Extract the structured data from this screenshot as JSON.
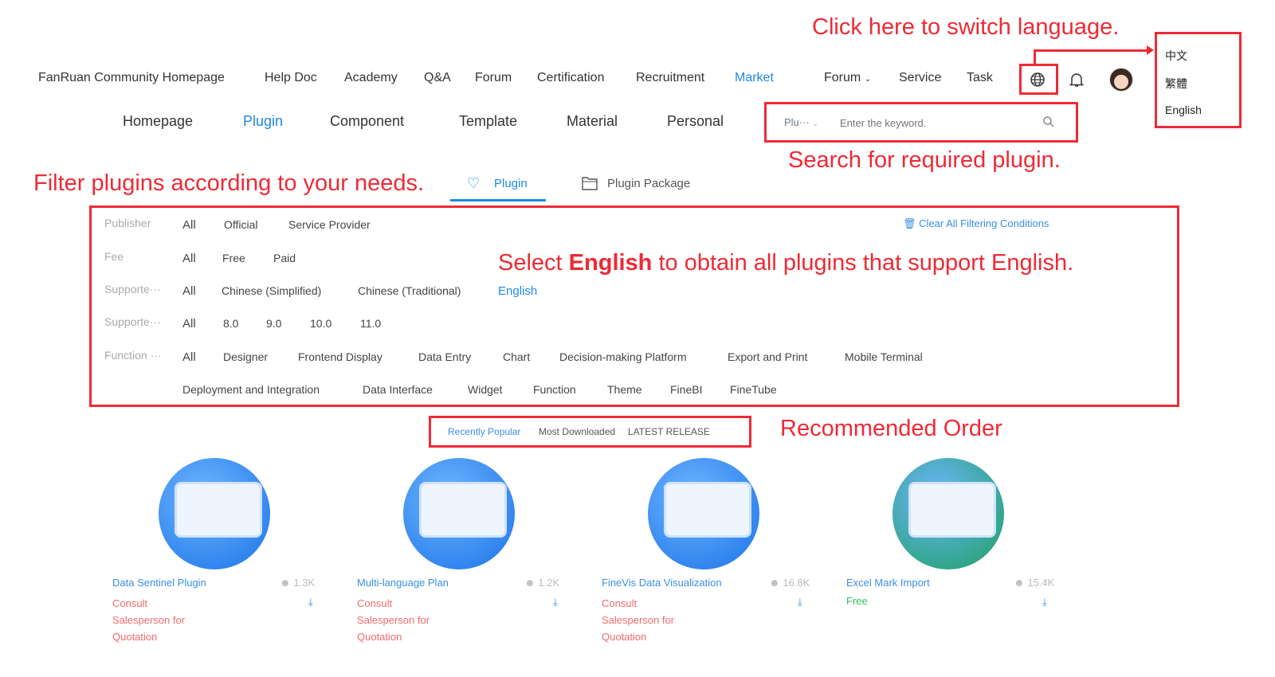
{
  "top_nav": {
    "items": [
      "FanRuan Community Homepage",
      "Help Doc",
      "Academy",
      "Q&A",
      "Forum",
      "Certification",
      "Recruitment",
      "Market"
    ],
    "active": "Market",
    "right": [
      "Forum",
      "Service",
      "Task"
    ]
  },
  "language_menu": {
    "options": [
      "中文",
      "繁體",
      "English"
    ]
  },
  "sub_nav": {
    "items": [
      "Homepage",
      "Plugin",
      "Component",
      "Template",
      "Material",
      "Personal"
    ],
    "active": "Plugin"
  },
  "search": {
    "scope": "Plu···",
    "placeholder": "Enter the keyword."
  },
  "annotations": {
    "language": "Click here to switch language.",
    "search": "Search for required plugin.",
    "filter": "Filter plugins according to your needs.",
    "english_pre": "Select ",
    "english_bold": "English",
    "english_post": " to obtain all plugins that support English.",
    "order": "Recommended Order"
  },
  "tabs": [
    "Plugin",
    "Plugin Package"
  ],
  "filters": {
    "clear": "Clear All Filtering Conditions",
    "rows": [
      {
        "label": "Publisher",
        "values": [
          "All",
          "Official",
          "Service Provider"
        ]
      },
      {
        "label": "Fee",
        "values": [
          "All",
          "Free",
          "Paid"
        ]
      },
      {
        "label": "Supporte···",
        "values": [
          "All",
          "Chinese (Simplified)",
          "Chinese (Traditional)",
          "English"
        ]
      },
      {
        "label": "Supporte···",
        "values": [
          "All",
          "8.0",
          "9.0",
          "10.0",
          "11.0"
        ]
      },
      {
        "label": "Function ···",
        "values": [
          "All",
          "Designer",
          "Frontend Display",
          "Data Entry",
          "Chart",
          "Decision-making Platform",
          "Export and Print",
          "Mobile Terminal"
        ]
      },
      {
        "label": "",
        "values": [
          "Deployment and Integration",
          "Data Interface",
          "Widget",
          "Function",
          "Theme",
          "FineBI",
          "FineTube"
        ]
      }
    ]
  },
  "sort": [
    "Recently Popular",
    "Most Downloaded",
    "LATEST RELEASE"
  ],
  "cards": [
    {
      "title": "Data Sentinel Plugin",
      "views": "1.3K",
      "price": [
        "Consult",
        "Salesperson for",
        "Quotation"
      ],
      "color": "#1a73e8"
    },
    {
      "title": "Multi-language Plan",
      "views": "1.2K",
      "price": [
        "Consult",
        "Salesperson for",
        "Quotation"
      ],
      "color": "#1a73e8"
    },
    {
      "title": "FineVis Data Visualization",
      "views": "16.8K",
      "price": [
        "Consult",
        "Salesperson for",
        "Quotation"
      ],
      "color": "#1a73e8"
    },
    {
      "title": "Excel Mark Import",
      "views": "15.4K",
      "price": [
        "Free"
      ],
      "color": "#1aa05e"
    }
  ]
}
